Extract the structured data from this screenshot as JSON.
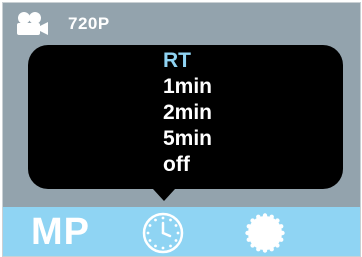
{
  "status_bar": {
    "resolution": "720P",
    "icon": "video-camera-icon"
  },
  "menu": {
    "items": [
      {
        "label": "RT",
        "selected": true
      },
      {
        "label": "1min",
        "selected": false
      },
      {
        "label": "2min",
        "selected": false
      },
      {
        "label": "5min",
        "selected": false
      },
      {
        "label": "off",
        "selected": false
      }
    ]
  },
  "mode_bar": {
    "mode_label": "MP",
    "icons": [
      "timer-icon",
      "settings-gear-icon"
    ]
  },
  "colors": {
    "screen_bg": "#93a3ad",
    "popup_bg": "#000000",
    "selected_text": "#8fd3f2",
    "mode_bar_bg": "#8fd4f3"
  }
}
